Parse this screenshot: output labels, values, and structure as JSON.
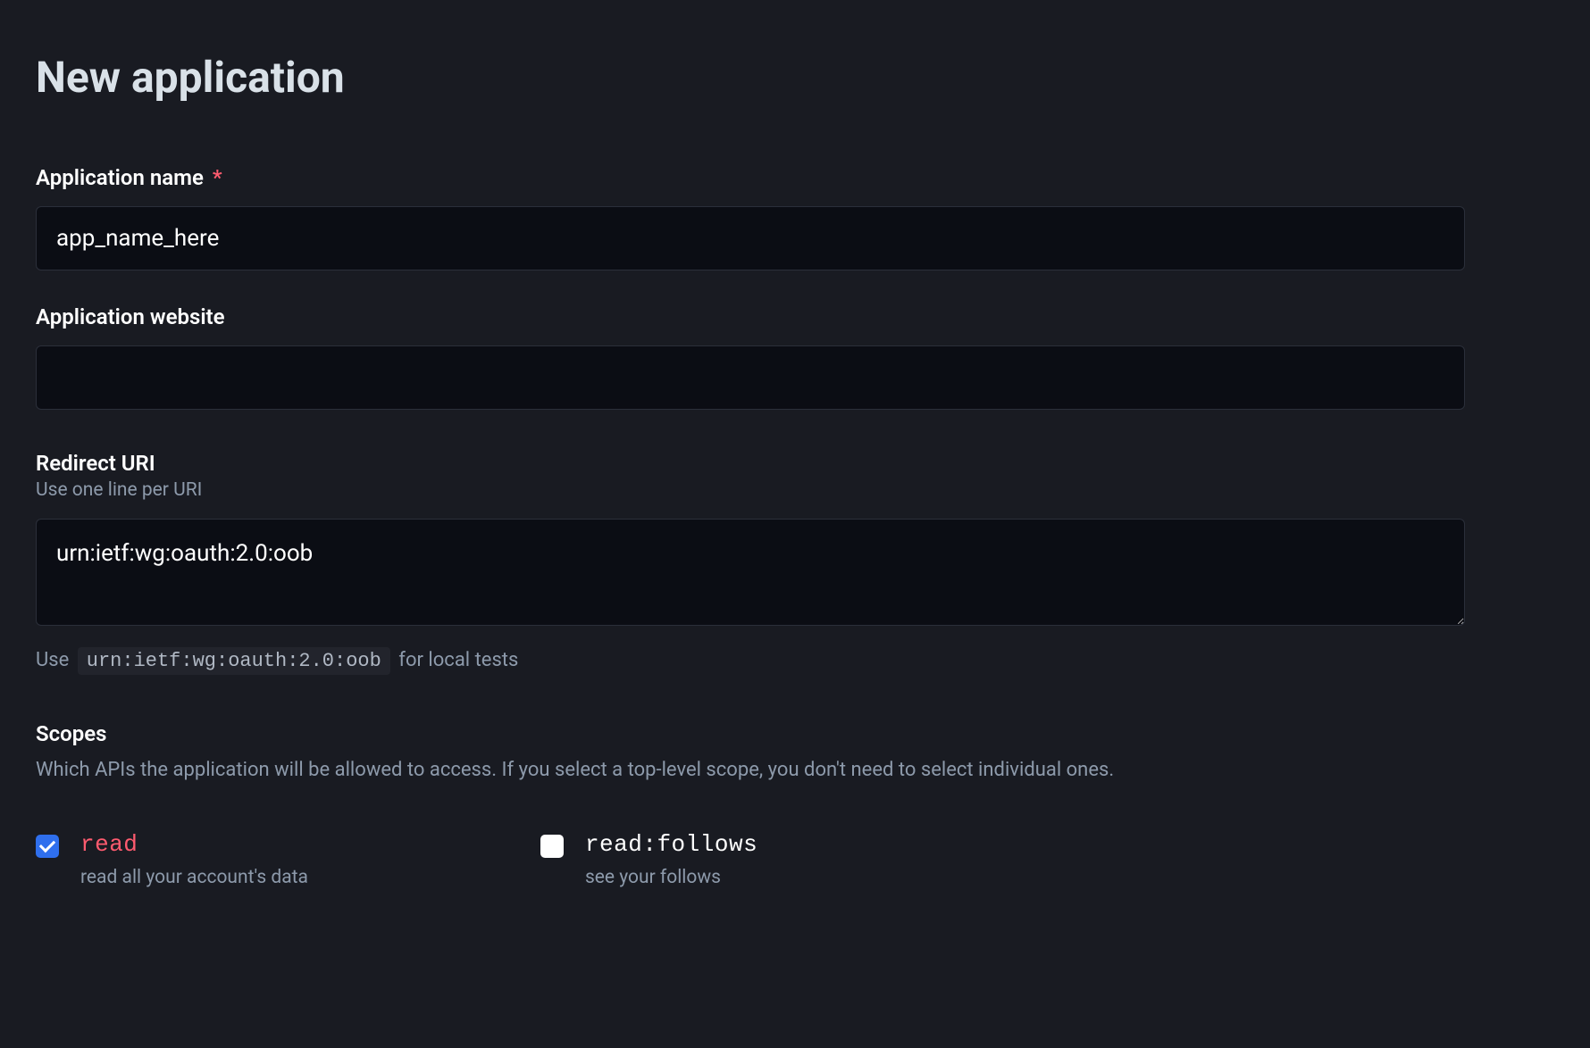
{
  "page": {
    "title": "New application"
  },
  "form": {
    "application_name": {
      "label": "Application name",
      "required_marker": "*",
      "value": "app_name_here"
    },
    "application_website": {
      "label": "Application website",
      "value": ""
    },
    "redirect_uri": {
      "label": "Redirect URI",
      "hint": "Use one line per URI",
      "value": "urn:ietf:wg:oauth:2.0:oob",
      "helper_prefix": "Use",
      "helper_code": "urn:ietf:wg:oauth:2.0:oob",
      "helper_suffix": "for local tests"
    }
  },
  "scopes": {
    "heading": "Scopes",
    "description": "Which APIs the application will be allowed to access. If you select a top-level scope, you don't need to select individual ones.",
    "items": [
      {
        "name": "read",
        "description": "read all your account's data",
        "checked": true,
        "top_level": true
      },
      {
        "name": "read:follows",
        "description": "see your follows",
        "checked": false,
        "top_level": false
      }
    ]
  }
}
